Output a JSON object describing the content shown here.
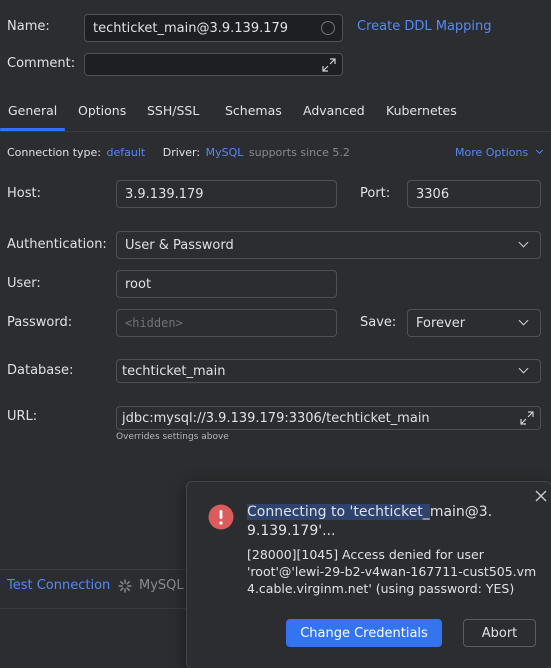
{
  "form": {
    "name_label": "Name:",
    "name_value": "techticket_main@3.9.139.179",
    "create_ddl_link": "Create DDL Mapping",
    "comment_label": "Comment:",
    "comment_value": ""
  },
  "tabs": [
    {
      "label": "General",
      "active": true
    },
    {
      "label": "Options"
    },
    {
      "label": "SSH/SSL"
    },
    {
      "label": "Schemas"
    },
    {
      "label": "Advanced"
    },
    {
      "label": "Kubernetes"
    }
  ],
  "connection": {
    "type_label": "Connection type:",
    "type_value": "default",
    "driver_label": "Driver:",
    "driver_value": "MySQL",
    "driver_note": "supports since 5.2",
    "more_options": "More Options"
  },
  "general": {
    "host_label": "Host:",
    "host_value": "3.9.139.179",
    "port_label": "Port:",
    "port_value": "3306",
    "auth_label": "Authentication:",
    "auth_value": "User & Password",
    "user_label": "User:",
    "user_value": "root",
    "password_label": "Password:",
    "password_placeholder": "<hidden>",
    "save_label": "Save:",
    "save_value": "Forever",
    "database_label": "Database:",
    "database_value": "techticket_main",
    "url_label": "URL:",
    "url_value": "jdbc:mysql://3.9.139.179:3306/techticket_main",
    "url_note": "Overrides settings above"
  },
  "footer": {
    "test_connection": "Test Connection",
    "status_text": "MySQL"
  },
  "popup": {
    "title_highlighted": "Connecting to 'techticket_",
    "title_rest_line1": "main@3.",
    "title_line2": "9.139.179'...",
    "message_line1": "[28000][1045] Access denied for user",
    "message_line2": "'root'@'lewi-29-b2-v4wan-167711-cust505.vm",
    "message_line3": "4.cable.virginm.net' (using password: YES)",
    "change_credentials": "Change Credentials",
    "abort": "Abort"
  },
  "colors": {
    "background": "#2b2d30",
    "field_bg": "#1e1f22",
    "accent": "#3574f0",
    "link": "#548af7",
    "error": "#db5c5c",
    "highlight": "#2e436e"
  }
}
